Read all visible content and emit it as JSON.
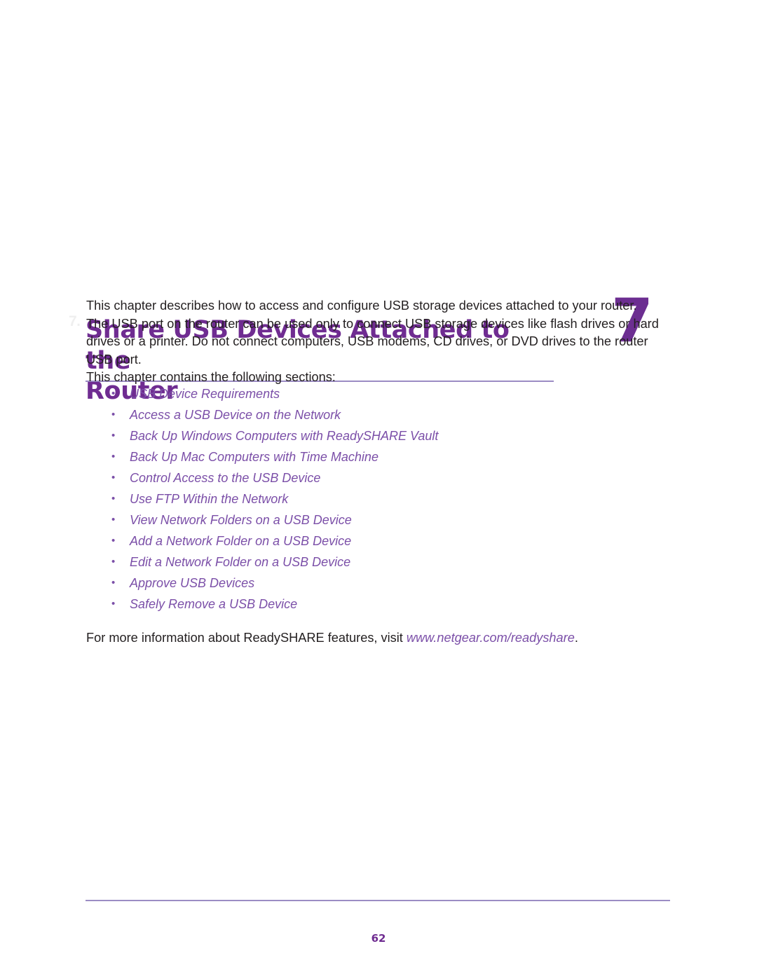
{
  "colors": {
    "heading_purple": "#6f2c91",
    "chapter_number_purple": "#6c2e91",
    "link_purple": "#7b4fa8",
    "rule_purple": "#9b8cc4",
    "body_text": "#231f20",
    "page_background": "#ffffff"
  },
  "chapter": {
    "marker": "7.",
    "title": "Share USB Devices Attached to the Router",
    "title_line_1": "Share USB Devices Attached to the",
    "title_line_2": "Router",
    "number": "7"
  },
  "body": {
    "intro_paragraph": "This chapter describes how to access and configure USB storage devices attached to your router. The USB port on the router can be used only to connect USB storage devices like flash drives or hard drives or a printer. Do not connect computers, USB modems, CD drives, or DVD drives to the router USB port.",
    "sections_lead": "This chapter contains the following sections:",
    "bullet_glyph": "•"
  },
  "sections": [
    {
      "label": "USB Device Requirements"
    },
    {
      "label": "Access a USB Device on the Network"
    },
    {
      "label": "Back Up Windows Computers with ReadySHARE Vault"
    },
    {
      "label": "Back Up Mac Computers with Time Machine"
    },
    {
      "label": "Control Access to the USB Device"
    },
    {
      "label": "Use FTP Within the Network"
    },
    {
      "label": "View Network Folders on a USB Device"
    },
    {
      "label": "Add a Network Folder on a USB Device"
    },
    {
      "label": "Edit a Network Folder on a USB Device"
    },
    {
      "label": "Approve USB Devices"
    },
    {
      "label": "Safely Remove a USB Device"
    }
  ],
  "closing": {
    "text_before_url": "For more information about ReadySHARE features, visit ",
    "url_text": "www.netgear.com/readyshare",
    "text_after_url": "."
  },
  "footer": {
    "page_number": "62"
  }
}
